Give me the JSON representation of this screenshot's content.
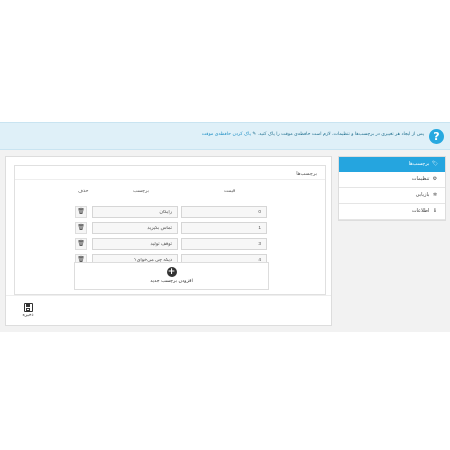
{
  "banner": {
    "text": "پس از ایجاد هر تغییری در برچسب‌ها و تنظیمات، لازم است حافظه‌ی موقت را پاک کنید.",
    "link": "پاک کردن حافظه‌ی موقت"
  },
  "sidebar": {
    "items": [
      {
        "label": "برچسب‌ها",
        "icon": "tags-icon"
      },
      {
        "label": "تنظیمات",
        "icon": "cogs-icon"
      },
      {
        "label": "بازیابی",
        "icon": "gear-icon"
      },
      {
        "label": "اطلاعات",
        "icon": "info-icon"
      }
    ]
  },
  "panel": {
    "title": "برچسب‌ها",
    "headers": {
      "price": "قیمت",
      "label": "برچسب",
      "delete": "حذف"
    },
    "rows": [
      {
        "price": "0",
        "label": "رایگان"
      },
      {
        "price": "1",
        "label": "تماس بگیرید"
      },
      {
        "price": "3",
        "label": "توقف تولید"
      },
      {
        "price": "4",
        "label": "دیگه چی می‌خوای؟"
      }
    ],
    "add_label": "افزودن برچسب جدید"
  },
  "footer": {
    "save_label": "ذخیره"
  }
}
